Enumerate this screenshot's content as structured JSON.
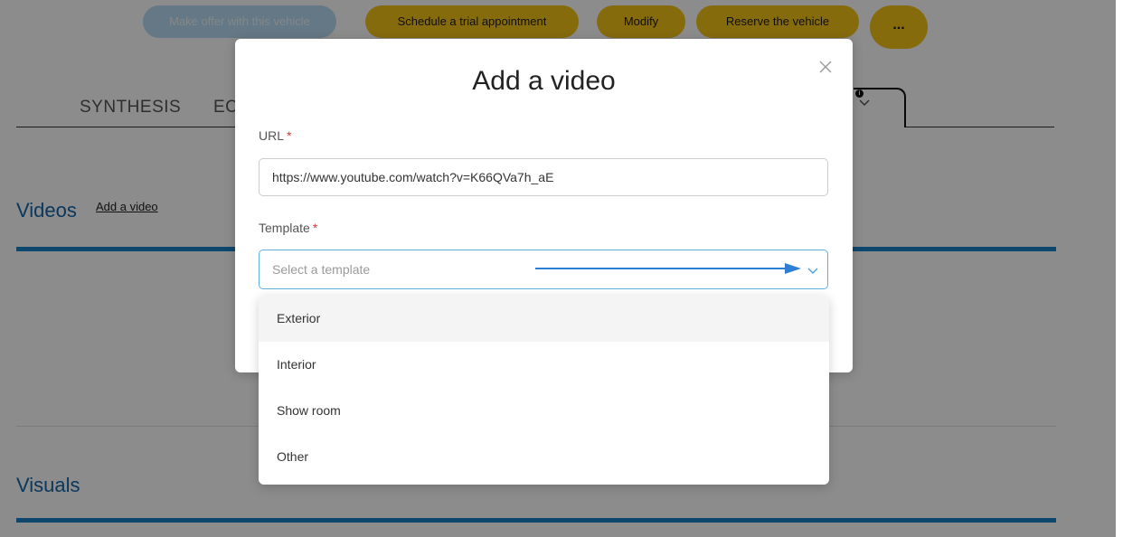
{
  "actions": {
    "make_offer": "Make offer with this vehicle",
    "schedule_trial": "Schedule a trial appointment",
    "modify": "Modify",
    "reserve": "Reserve the vehicle",
    "more": "..."
  },
  "tabs": {
    "synthesis": "SYNTHESIS",
    "second_partial": "EC"
  },
  "sections": {
    "videos_title": "Videos",
    "videos_add_link": "Add a video",
    "visuals_title": "Visuals"
  },
  "modal": {
    "title": "Add a video",
    "url_label": "URL",
    "url_required": "*",
    "url_value": "https://www.youtube.com/watch?v=K66QVa7h_aE",
    "template_label": "Template",
    "template_required": "*",
    "template_placeholder": "Select a template",
    "template_options": [
      "Exterior",
      "Interior",
      "Show room",
      "Other"
    ],
    "highlighted_option_index": 0
  },
  "icons": {
    "close": "close-icon",
    "chevron": "chevron-down-icon",
    "info": "info-icon",
    "arrow": "annotation-arrow"
  },
  "colors": {
    "accent_yellow": "#f5c319",
    "section_blue": "#1565a8",
    "bar_blue": "#1b82c7",
    "focus_blue": "#5fb0df",
    "required_red": "#d43a3a",
    "arrow_blue": "#2d7fd3"
  }
}
